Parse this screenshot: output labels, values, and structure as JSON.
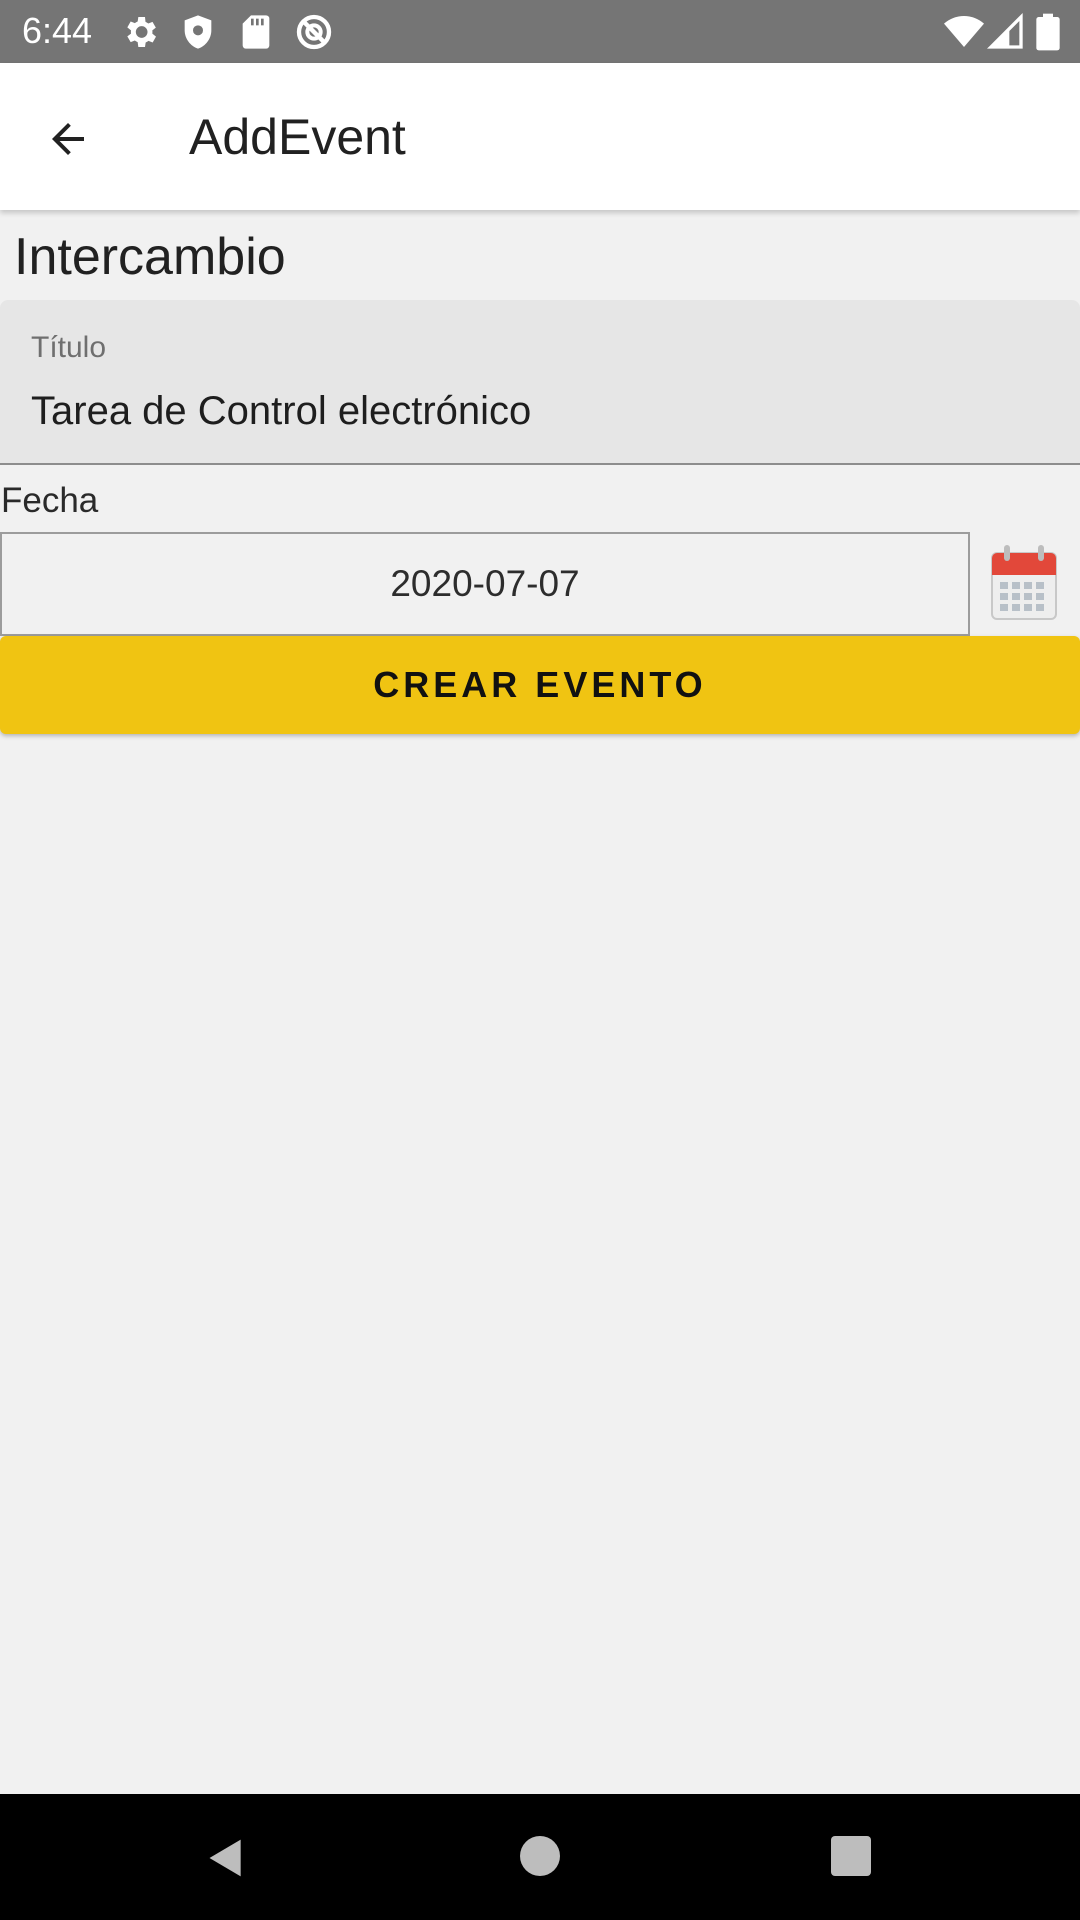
{
  "status_bar": {
    "time": "6:44",
    "icons": [
      "settings-icon",
      "shield-icon",
      "sd-card-icon",
      "no-sync-icon",
      "wifi-icon",
      "signal-icon",
      "battery-icon"
    ]
  },
  "app_bar": {
    "title": "AddEvent",
    "back_icon": "arrow-back-icon"
  },
  "form": {
    "section_heading": "Intercambio",
    "title_field": {
      "label": "Título",
      "value": "Tarea de Control electrónico"
    },
    "date": {
      "label": "Fecha",
      "value": "2020-07-07",
      "picker_icon": "calendar-icon"
    },
    "submit_label": "CREAR EVENTO"
  },
  "colors": {
    "status_bar": "#757575",
    "accent": "#f0c412",
    "background": "#f1f1f1",
    "calendar_red": "#e2483a"
  },
  "nav_bar": {
    "icons": [
      "nav-back-icon",
      "nav-home-icon",
      "nav-recents-icon"
    ]
  }
}
